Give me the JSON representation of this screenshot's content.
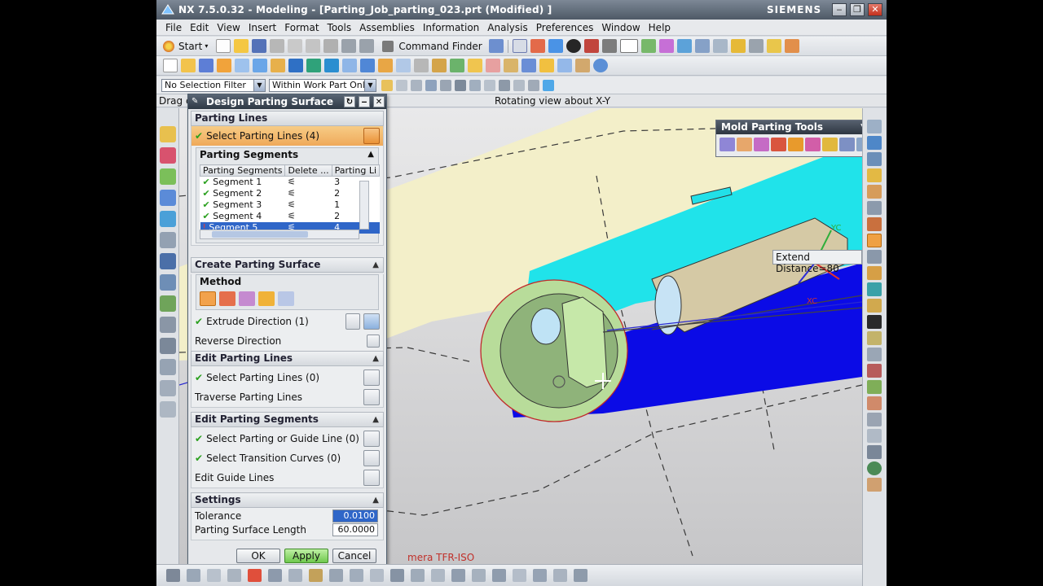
{
  "window": {
    "title": "NX 7.5.0.32 - Modeling - [Parting_Job_parting_023.prt (Modified) ]",
    "brand": "SIEMENS",
    "minimize": "‒",
    "restore": "❐",
    "close": "✕"
  },
  "menu": [
    "File",
    "Edit",
    "View",
    "Insert",
    "Format",
    "Tools",
    "Assemblies",
    "Information",
    "Analysis",
    "Preferences",
    "Window",
    "Help"
  ],
  "toolbar": {
    "start_label": "Start",
    "command_finder_label": "Command Finder",
    "selection_filter": "No Selection Filter",
    "scope": "Within Work Part Only"
  },
  "cue_line": {
    "cue": "Drag c",
    "status": "Rotating view about X-Y"
  },
  "viewport": {
    "camera_label": "mera TFR-ISO",
    "extend_tip": "Extend Distance=80",
    "axis_labels": {
      "yc": "YC",
      "xc": "XC"
    }
  },
  "mold_parting_tools": {
    "title": "Mold Parting Tools"
  },
  "dialog": {
    "title": "Design Parting Surface",
    "parting_lines": {
      "header": "Parting Lines",
      "select_label": "Select Parting Lines (4)",
      "segments_header": "Parting Segments",
      "columns": [
        "Parting Segments",
        "Delete ...",
        "Parting Li"
      ],
      "rows": [
        {
          "name": "Segment 1",
          "value": "3"
        },
        {
          "name": "Segment 2",
          "value": "2"
        },
        {
          "name": "Segment 3",
          "value": "1"
        },
        {
          "name": "Segment 4",
          "value": "2"
        },
        {
          "name": "Segment 5",
          "value": "4"
        }
      ]
    },
    "create_surface": {
      "header": "Create Parting Surface",
      "method_label": "Method",
      "extrude_direction": "Extrude Direction (1)",
      "reverse_direction": "Reverse Direction"
    },
    "edit_parting_lines": {
      "header": "Edit Parting Lines",
      "select_label": "Select Parting Lines (0)",
      "traverse_label": "Traverse Parting Lines"
    },
    "edit_segments": {
      "header": "Edit Parting Segments",
      "guide_label": "Select Parting or Guide Line (0)",
      "transition_label": "Select Transition Curves (0)",
      "edit_guide_label": "Edit Guide Lines"
    },
    "settings": {
      "header": "Settings",
      "tolerance_label": "Tolerance",
      "tolerance_value": "0.0100",
      "length_label": "Parting Surface Length",
      "length_value": "60.0000"
    },
    "buttons": {
      "ok": "OK",
      "apply": "Apply",
      "cancel": "Cancel"
    }
  },
  "colors": {
    "cyan_body": "#1ce4ec",
    "blue_body": "#0a0ae6",
    "face_green": "#bcdf9c",
    "active_select": "#f2a24c"
  }
}
